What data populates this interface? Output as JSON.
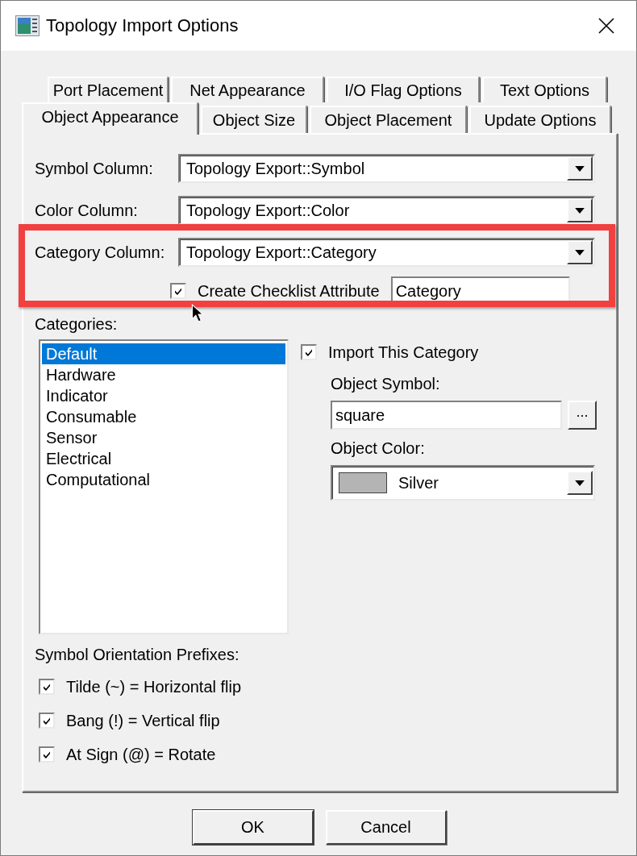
{
  "window": {
    "title": "Topology Import Options"
  },
  "tab_rows": [
    {
      "tabs": [
        {
          "label": "Port Placement",
          "selected": false
        },
        {
          "label": "Net Appearance",
          "selected": false
        },
        {
          "label": "I/O Flag Options",
          "selected": false
        },
        {
          "label": "Text Options",
          "selected": false
        }
      ]
    },
    {
      "tabs": [
        {
          "label": "Object Appearance",
          "selected": true
        },
        {
          "label": "Object Size",
          "selected": false
        },
        {
          "label": "Object Placement",
          "selected": false
        },
        {
          "label": "Update Options",
          "selected": false
        }
      ]
    }
  ],
  "columns": [
    {
      "label": "Symbol Column:",
      "value": "Topology Export::Symbol"
    },
    {
      "label": "Color Column:",
      "value": "Topology Export::Color"
    },
    {
      "label": "Category Column:",
      "value": "Topology Export::Category"
    }
  ],
  "checklist_attribute": {
    "label": "Create Checklist Attribute",
    "checked": true,
    "value": "Category"
  },
  "categories": {
    "label": "Categories:",
    "items": [
      {
        "label": "Default",
        "selected": true
      },
      {
        "label": "Hardware",
        "selected": false
      },
      {
        "label": "Indicator",
        "selected": false
      },
      {
        "label": "Consumable",
        "selected": false
      },
      {
        "label": "Sensor",
        "selected": false
      },
      {
        "label": "Electrical",
        "selected": false
      },
      {
        "label": "Computational",
        "selected": false
      }
    ]
  },
  "import_category": {
    "label": "Import This Category",
    "checked": true
  },
  "object_symbol": {
    "label": "Object Symbol:",
    "value": "square",
    "browse_button": "..."
  },
  "object_color": {
    "label": "Object Color:",
    "value": "Silver",
    "color": "#b4b4b4"
  },
  "orientation": {
    "label": "Symbol Orientation Prefixes:",
    "options": [
      {
        "label": "Tilde (~) = Horizontal flip",
        "checked": true
      },
      {
        "label": "Bang (!) = Vertical flip",
        "checked": true
      },
      {
        "label": "At Sign (@) = Rotate",
        "checked": true
      }
    ]
  },
  "buttons": [
    {
      "label": "OK"
    },
    {
      "label": "Cancel"
    }
  ]
}
